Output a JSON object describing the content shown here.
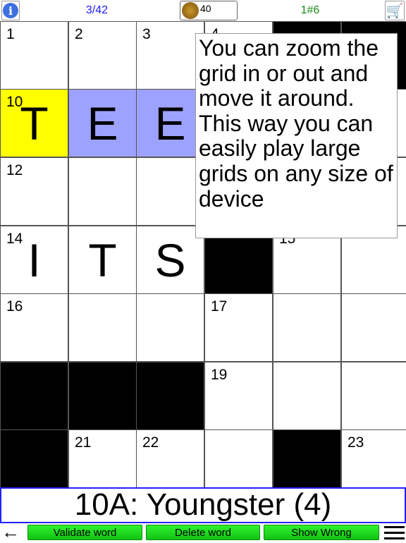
{
  "header": {
    "info_icon": "info-icon",
    "progress": "3/42",
    "coins": "40",
    "puzzle_id": "1#6",
    "cart_icon": "cart-icon"
  },
  "grid": {
    "cells": [
      [
        {
          "n": "1"
        },
        {
          "n": "2"
        },
        {
          "n": "3"
        },
        {
          "n": "4"
        },
        {
          "black": true
        },
        {
          "black": true
        }
      ],
      [
        {
          "n": "10",
          "l": "T",
          "state": "active"
        },
        {
          "l": "E",
          "state": "selected"
        },
        {
          "l": "E",
          "state": "selected"
        },
        {
          "state": "selected"
        },
        {},
        {}
      ],
      [
        {
          "n": "12"
        },
        {},
        {},
        {},
        {},
        {}
      ],
      [
        {
          "n": "14",
          "l": "I"
        },
        {
          "l": "T"
        },
        {
          "l": "S"
        },
        {
          "black": true
        },
        {
          "n": "15"
        },
        {}
      ],
      [
        {
          "n": "16"
        },
        {},
        {},
        {
          "n": "17"
        },
        {},
        {}
      ],
      [
        {
          "black": true
        },
        {
          "black": true
        },
        {
          "black": true
        },
        {
          "n": "19"
        },
        {},
        {}
      ],
      [
        {
          "black": true
        },
        {
          "n": "21"
        },
        {
          "n": "22"
        },
        {},
        {
          "black": true
        },
        {
          "n": "23"
        }
      ]
    ]
  },
  "tooltip": "You can zoom the grid in or out and move it around. This way you can easily play large grids on any size of device",
  "clue": "10A: Youngster (4)",
  "toolbar": {
    "back": "←",
    "validate": "Validate word",
    "delete": "Delete word",
    "show_wrong": "Show Wrong",
    "menu_icon": "menu-icon"
  },
  "colors": {
    "active": "#ffff00",
    "selected": "#9ea2ff",
    "button": "#22e022",
    "progress": "#1a1aff",
    "puzzle": "#1a8a1a"
  }
}
